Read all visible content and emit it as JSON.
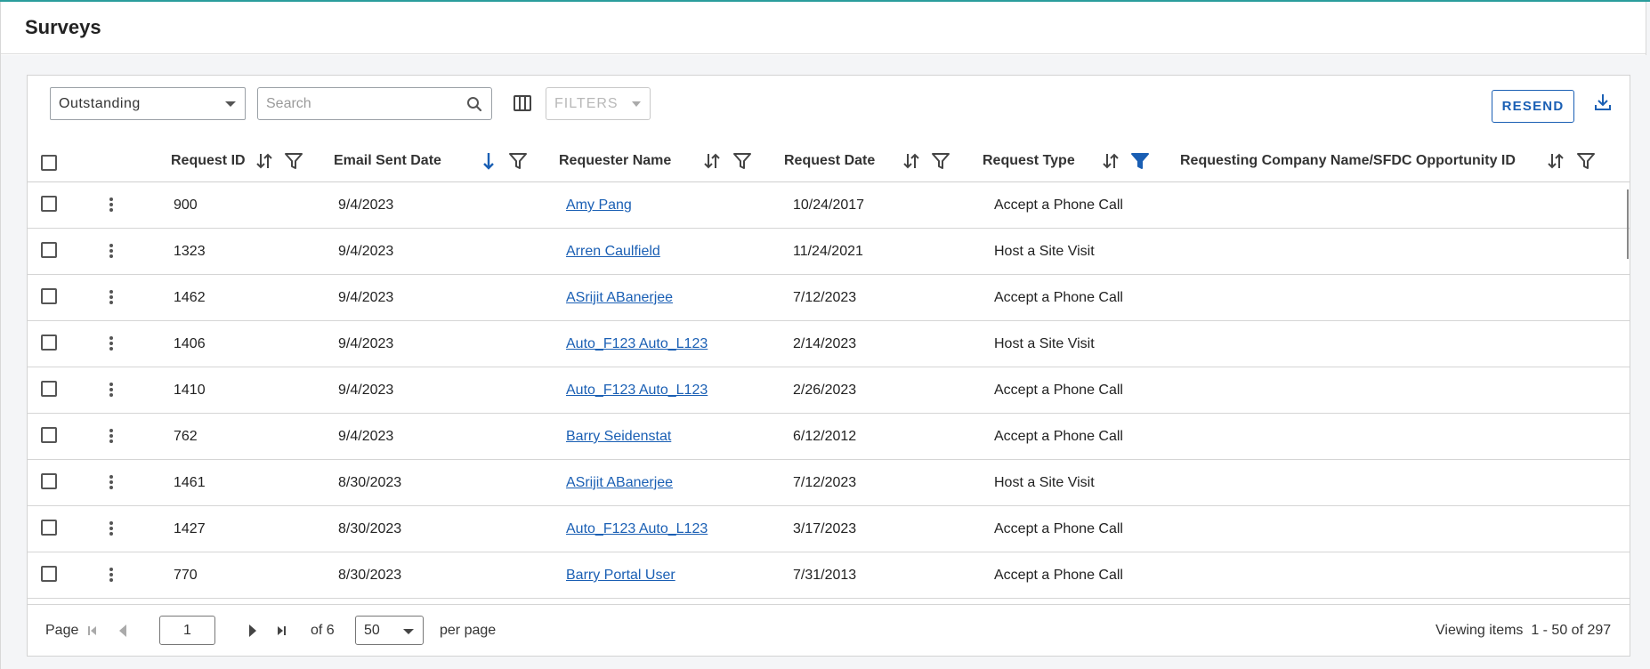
{
  "page": {
    "title": "Surveys"
  },
  "toolbar": {
    "status_value": "Outstanding",
    "search_placeholder": "Search",
    "filters_label": "FILTERS",
    "resend_label": "RESEND"
  },
  "colors": {
    "accent": "#1a5fb4",
    "top_line": "#2a9d9c",
    "link": "#1a5fb4"
  },
  "table": {
    "columns": [
      {
        "label": "Request ID",
        "sort": "none",
        "filter_active": false
      },
      {
        "label": "Email Sent Date",
        "sort": "descending",
        "filter_active": false
      },
      {
        "label": "Requester Name",
        "sort": "none",
        "filter_active": false
      },
      {
        "label": "Request Date",
        "sort": "none",
        "filter_active": false
      },
      {
        "label": "Request Type",
        "sort": "none",
        "filter_active": true
      },
      {
        "label": "Requesting Company Name/SFDC Opportunity ID",
        "sort": "none",
        "filter_active": false
      }
    ],
    "rows": [
      {
        "id": "900",
        "email_sent": "9/4/2023",
        "requester": "Amy Pang",
        "request_date": "10/24/2017",
        "type": "Accept a Phone Call",
        "company": ""
      },
      {
        "id": "1323",
        "email_sent": "9/4/2023",
        "requester": "Arren Caulfield",
        "request_date": "11/24/2021",
        "type": "Host a Site Visit",
        "company": ""
      },
      {
        "id": "1462",
        "email_sent": "9/4/2023",
        "requester": "ASrijit ABanerjee",
        "request_date": "7/12/2023",
        "type": "Accept a Phone Call",
        "company": ""
      },
      {
        "id": "1406",
        "email_sent": "9/4/2023",
        "requester": "Auto_F123 Auto_L123",
        "request_date": "2/14/2023",
        "type": "Host a Site Visit",
        "company": ""
      },
      {
        "id": "1410",
        "email_sent": "9/4/2023",
        "requester": "Auto_F123 Auto_L123",
        "request_date": "2/26/2023",
        "type": "Accept a Phone Call",
        "company": ""
      },
      {
        "id": "762",
        "email_sent": "9/4/2023",
        "requester": "Barry Seidenstat",
        "request_date": "6/12/2012",
        "type": "Accept a Phone Call",
        "company": ""
      },
      {
        "id": "1461",
        "email_sent": "8/30/2023",
        "requester": "ASrijit ABanerjee",
        "request_date": "7/12/2023",
        "type": "Host a Site Visit",
        "company": ""
      },
      {
        "id": "1427",
        "email_sent": "8/30/2023",
        "requester": "Auto_F123 Auto_L123",
        "request_date": "3/17/2023",
        "type": "Accept a Phone Call",
        "company": ""
      },
      {
        "id": "770",
        "email_sent": "8/30/2023",
        "requester": "Barry Portal User",
        "request_date": "7/31/2013",
        "type": "Accept a Phone Call",
        "company": ""
      }
    ]
  },
  "pager": {
    "page_label": "Page",
    "current_page": "1",
    "of_label": "of 6",
    "per_page_value": "50",
    "per_page_label": "per page",
    "viewing_label": "Viewing items",
    "viewing_range": "1 - 50 of 297"
  },
  "icons": {
    "search": "search-icon",
    "columns": "columns-icon",
    "download": "download-icon",
    "sort": "sort-icon",
    "sort_desc": "sort-descending-icon",
    "filter": "filter-icon",
    "filter_active": "filter-active-icon",
    "kebab": "kebab-menu-icon",
    "first": "first-page-icon",
    "prev": "previous-page-icon",
    "next": "next-page-icon",
    "last": "last-page-icon"
  }
}
